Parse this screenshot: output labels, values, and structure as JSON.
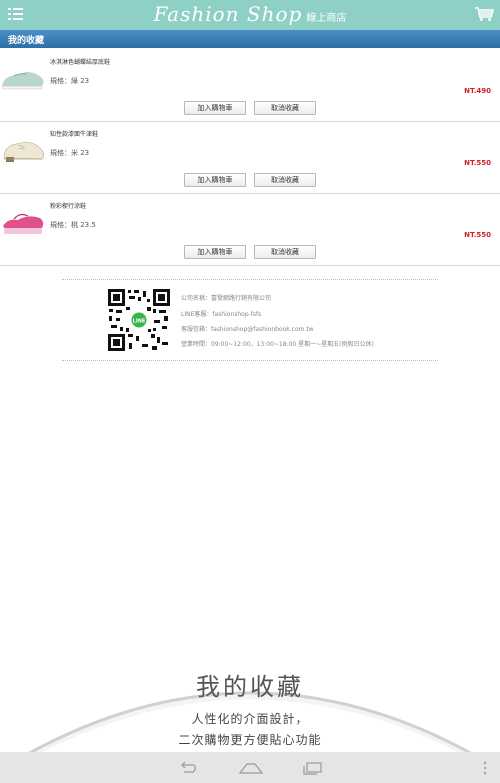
{
  "header": {
    "brand": "Fashion Shop",
    "subtitle": "線上商店",
    "menu_icon": "hamburger-icon",
    "cart_icon": "cart-icon"
  },
  "section": {
    "title": "我的收藏"
  },
  "favorites": [
    {
      "name": "冰淇淋色蝴蝶結厚底鞋",
      "spec": "規格：綠 23",
      "price": "NT.490",
      "add_label": "加入購物車",
      "remove_label": "取消收藏",
      "thumb_color": "#a9c8bf"
    },
    {
      "name": "知性款漆面牛津鞋",
      "spec": "規格：米 23",
      "price": "NT.550",
      "add_label": "加入購物車",
      "remove_label": "取消收藏",
      "thumb_color": "#e4ddc8"
    },
    {
      "name": "粉彩楔行涼鞋",
      "spec": "規格：桃 23.5",
      "price": "NT.550",
      "add_label": "加入購物車",
      "remove_label": "取消收藏",
      "thumb_color": "#d9467c"
    }
  ],
  "footer": {
    "company": "公司名稱：富發網路行銷有限公司",
    "line": "LINE客服：fashionshop-fsfs",
    "email": "客服信箱：fashionshop@fashionbook.com.tw",
    "hours": "營業時間：09:00~12:00，13:00~18:00 星期一~星期五(例假日公休)"
  },
  "promo": {
    "title": "我的收藏",
    "line1": "人性化的介面設計，",
    "line2": "二次購物更方便貼心功能"
  },
  "navbar": {
    "icons": [
      "back-icon",
      "home-icon",
      "recent-apps-icon",
      "overflow-menu-icon"
    ]
  }
}
